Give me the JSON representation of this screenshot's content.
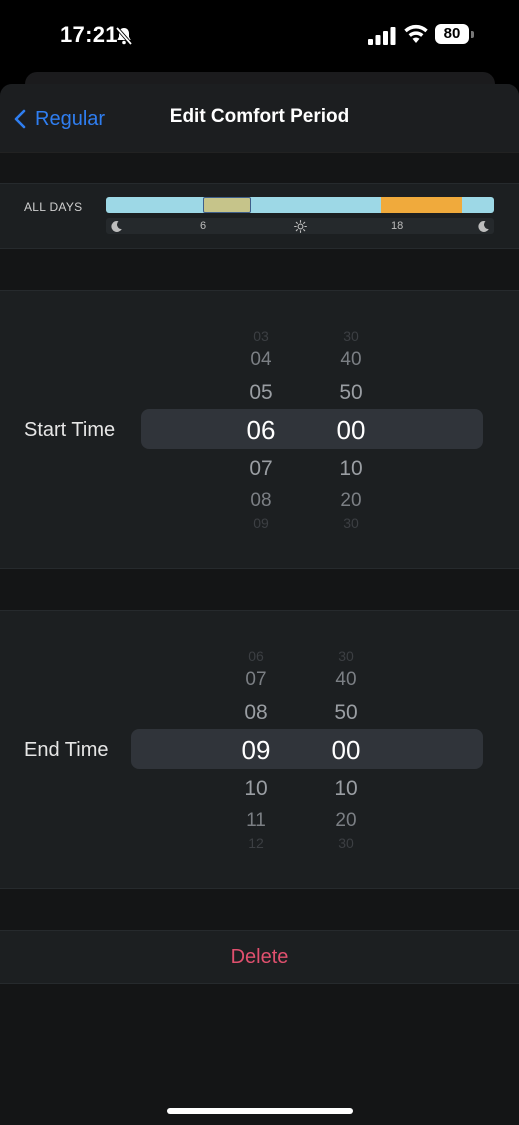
{
  "status": {
    "time": "17:21",
    "battery": "80"
  },
  "nav": {
    "back_label": "Regular",
    "title": "Edit Comfort Period"
  },
  "schedule": {
    "label": "ALL DAYS",
    "axis": [
      "6",
      "18"
    ],
    "colors": {
      "base": "#9dd8e6",
      "editing": "#c6c48a",
      "evening": "#f0aa3c"
    }
  },
  "start_time": {
    "label": "Start Time",
    "hours": [
      "03",
      "04",
      "05",
      "06",
      "07",
      "08",
      "09"
    ],
    "minutes": [
      "30",
      "40",
      "50",
      "00",
      "10",
      "20",
      "30"
    ],
    "selected_hour": "06",
    "selected_minute": "00"
  },
  "end_time": {
    "label": "End Time",
    "hours": [
      "06",
      "07",
      "08",
      "09",
      "10",
      "11",
      "12"
    ],
    "minutes": [
      "30",
      "40",
      "50",
      "00",
      "10",
      "20",
      "30"
    ],
    "selected_hour": "09",
    "selected_minute": "00"
  },
  "delete_label": "Delete",
  "accent": "#2f7ef0",
  "destructive": "#e0506e"
}
